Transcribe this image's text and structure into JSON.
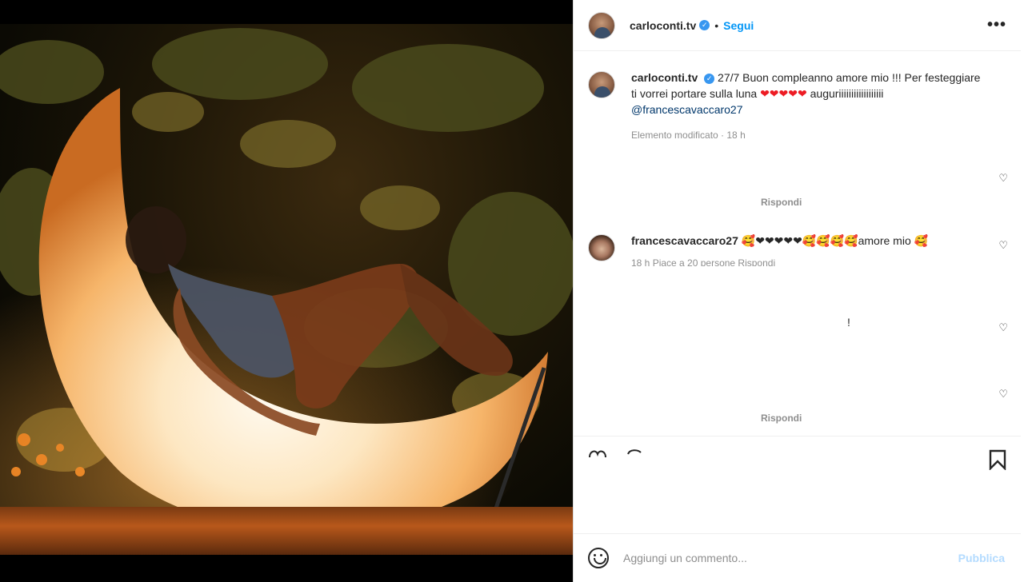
{
  "post": {
    "username": "carloconti.tv",
    "follow_label": "Segui",
    "separator": "•",
    "more_label": "•••"
  },
  "caption": {
    "username": "carloconti.tv",
    "text": "27/7 Buon compleanno amore mio !!! Per festeggiare ti vorrei portare sulla luna",
    "hearts": "❤❤❤❤❤",
    "text2": "auguriiiiiiiiiiiiiiiiii",
    "mention": "@francescavaccaro27",
    "meta": "Elemento modificato · 18 h"
  },
  "reply_1": "Rispondi",
  "comment": {
    "username": "francescavaccaro27",
    "emojis": "🥰❤❤❤❤❤🥰🥰🥰🥰",
    "text": "amore mio",
    "emoji_end": "🥰",
    "meta": "18 h   Piace a 20 persone   Rispondi"
  },
  "exclamation": "!",
  "reply_2": "Rispondi",
  "add_comment": {
    "placeholder": "Aggiungi un commento...",
    "publish_label": "Pubblica"
  },
  "colors": {
    "accent": "#0095f6",
    "verified": "#3897f0",
    "heart": "#ed4956"
  }
}
